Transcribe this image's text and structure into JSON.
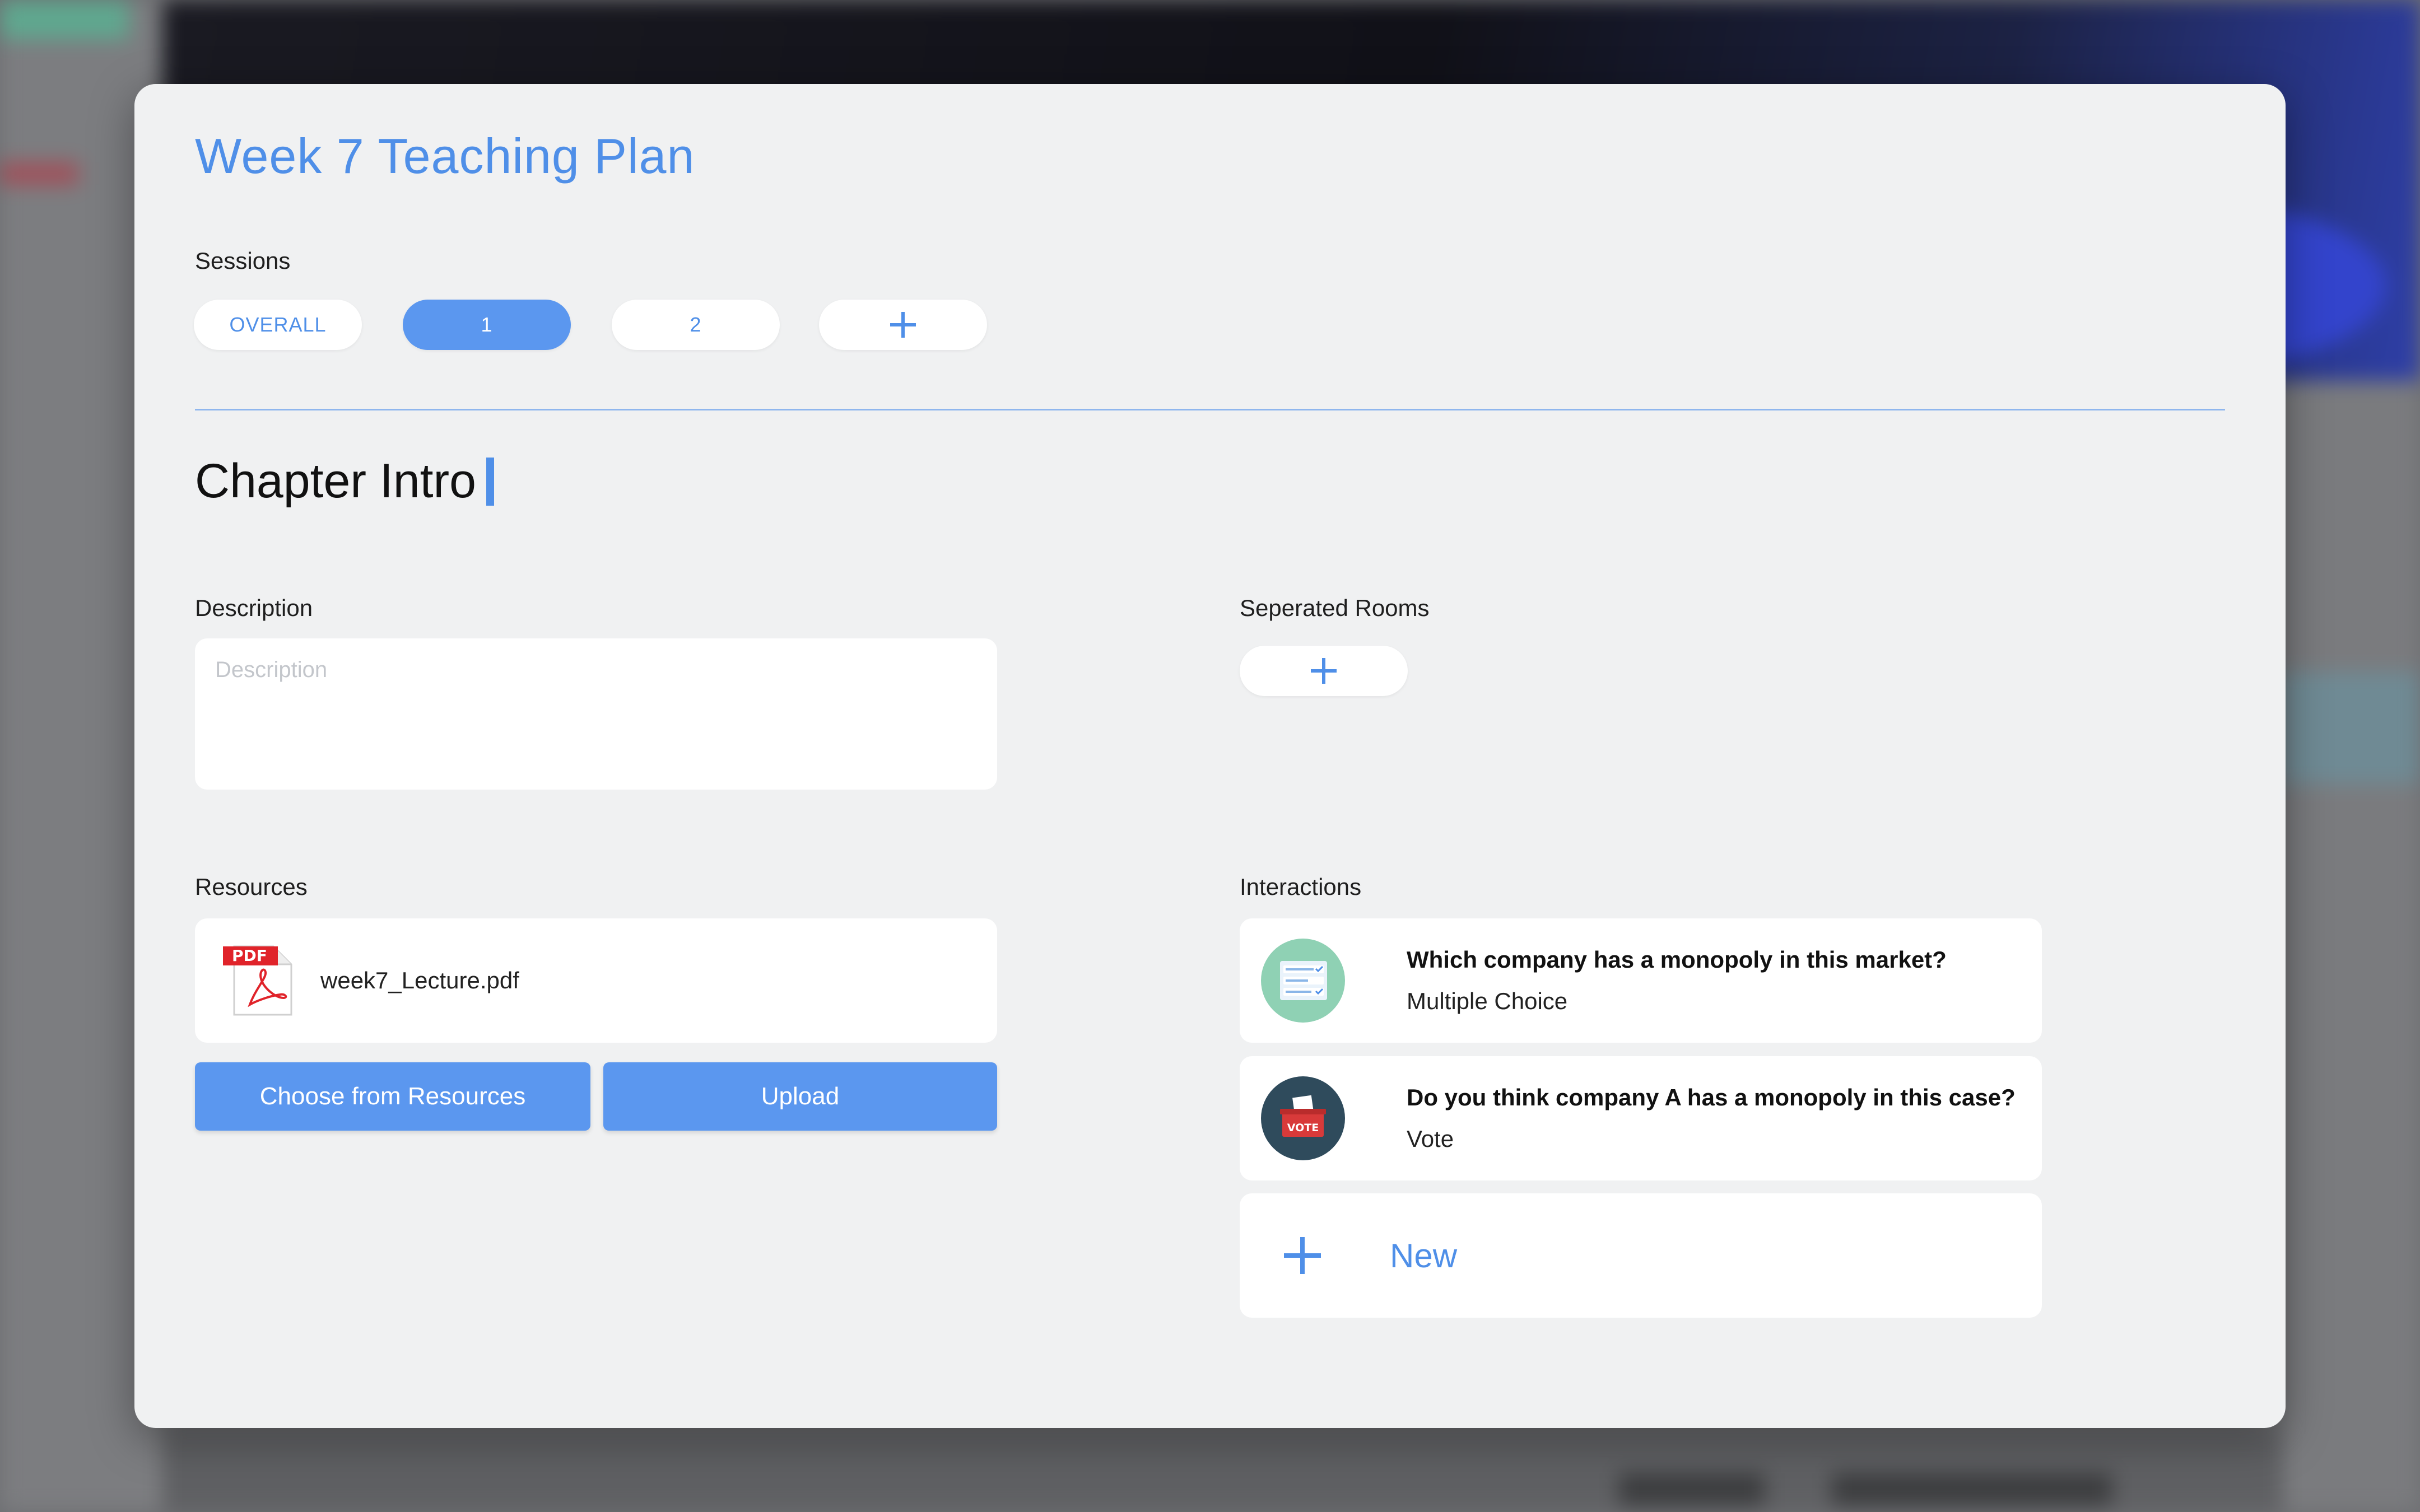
{
  "modal": {
    "title": "Week 7 Teaching Plan",
    "sessions_label": "Sessions",
    "sessions": [
      {
        "label": "OVERALL",
        "active": false
      },
      {
        "label": "1",
        "active": true
      },
      {
        "label": "2",
        "active": false
      }
    ],
    "add_session_icon": "plus-icon",
    "chapter_title": "Chapter Intro",
    "description": {
      "label": "Description",
      "placeholder": "Description",
      "value": ""
    },
    "separated_rooms": {
      "label": "Seperated Rooms",
      "add_icon": "plus-icon"
    },
    "resources": {
      "label": "Resources",
      "files": [
        {
          "name": "week7_Lecture.pdf",
          "icon": "pdf-file-icon",
          "badge": "PDF"
        }
      ],
      "choose_button": "Choose from Resources",
      "upload_button": "Upload"
    },
    "interactions": {
      "label": "Interactions",
      "items": [
        {
          "question": "Which company has a monopoly in this market?",
          "type": "Multiple Choice",
          "icon": "multiple-choice-icon"
        },
        {
          "question": "Do you think company A has a monopoly in this case?",
          "type": "Vote",
          "icon": "vote-box-icon",
          "icon_text": "VOTE"
        }
      ],
      "new_label": "New"
    }
  },
  "colors": {
    "accent": "#4f8fe8",
    "active_pill": "#5b97ef",
    "modal_bg": "#f0f1f2",
    "pdf_red": "#e0232a",
    "mc_icon_bg": "#8fd1b4",
    "vote_icon_bg": "#2f4b5c"
  }
}
